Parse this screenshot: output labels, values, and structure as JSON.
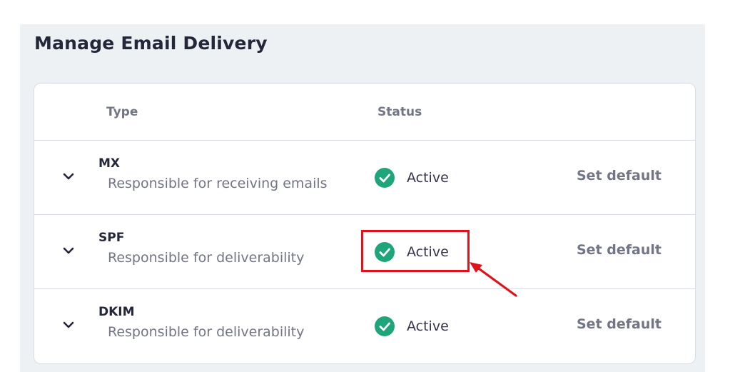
{
  "page": {
    "title": "Manage Email Delivery"
  },
  "table": {
    "headers": {
      "type": "Type",
      "status": "Status"
    },
    "rows": [
      {
        "name": "MX",
        "description": "Responsible for receiving emails",
        "status": "Active",
        "action": "Set default"
      },
      {
        "name": "SPF",
        "description": "Responsible for deliverability",
        "status": "Active",
        "action": "Set default"
      },
      {
        "name": "DKIM",
        "description": "Responsible for deliverability",
        "status": "Active",
        "action": "Set default"
      }
    ]
  },
  "icons": {
    "expand": "chevron-down-icon",
    "status": "check-circle-icon"
  },
  "colors": {
    "active_green": "#1fa57a",
    "annotation_red": "#e0121b"
  },
  "annotation": {
    "highlighted_row": "SPF",
    "highlighted_element": "status"
  }
}
